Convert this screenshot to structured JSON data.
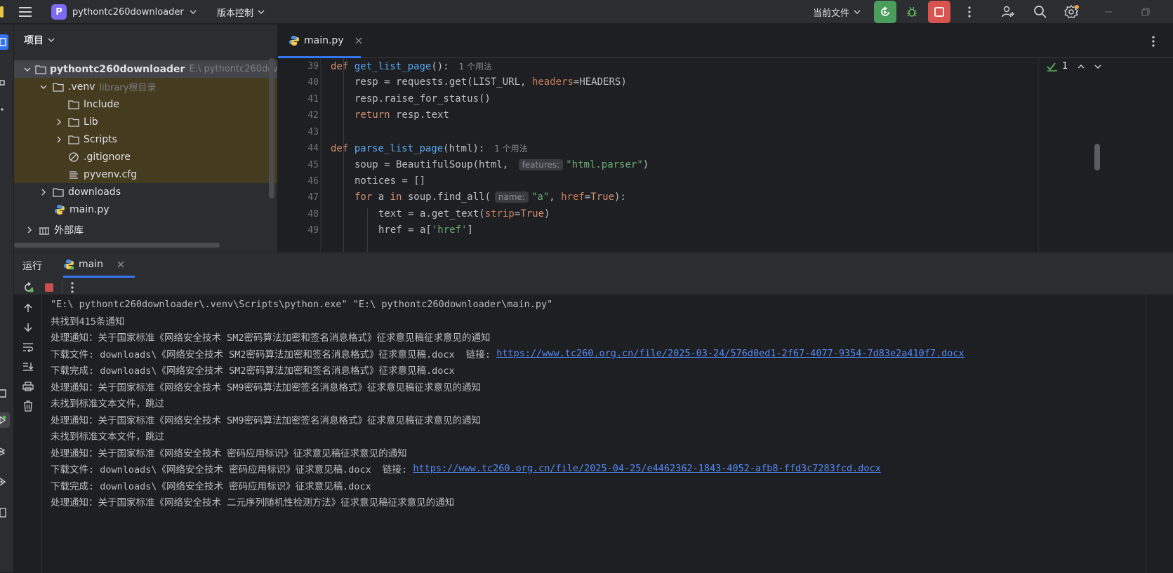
{
  "titlebar": {
    "project_badge": "P",
    "project_name": "pythontc260downloader",
    "vcs_menu": "版本控制",
    "run_config": "当前文件",
    "icons": [
      "hamburger-icon",
      "run-icon",
      "debug-icon",
      "stop-icon",
      "more-icon",
      "add-user-icon",
      "search-icon",
      "settings-icon",
      "minimize-icon",
      "restore-icon"
    ]
  },
  "project_panel": {
    "header": "项目",
    "tree": [
      {
        "label": "pythontc260downloader",
        "hint": "E:\\ pythontc260dow",
        "icon": "folder-icon"
      },
      {
        "label": ".venv",
        "hint": "library根目录",
        "icon": "folder-icon"
      },
      {
        "label": "Include",
        "icon": "folder-icon"
      },
      {
        "label": "Lib",
        "icon": "folder-icon"
      },
      {
        "label": "Scripts",
        "icon": "folder-icon"
      },
      {
        "label": ".gitignore",
        "icon": "ignore-file-icon"
      },
      {
        "label": "pyvenv.cfg",
        "icon": "config-file-icon"
      },
      {
        "label": "downloads",
        "icon": "folder-icon"
      },
      {
        "label": "main.py",
        "icon": "python-file-icon"
      },
      {
        "label": "外部库",
        "icon": "library-icon"
      }
    ]
  },
  "editor": {
    "tab_label": "main.py",
    "inspection_count": "1",
    "lines": [
      {
        "n": "39",
        "usage": "1 个用法"
      },
      {
        "n": "40"
      },
      {
        "n": "41"
      },
      {
        "n": "42"
      },
      {
        "n": "43"
      },
      {
        "n": "44",
        "usage": "1 个用法"
      },
      {
        "n": "45"
      },
      {
        "n": "46"
      },
      {
        "n": "47"
      },
      {
        "n": "48"
      },
      {
        "n": "49"
      }
    ],
    "code": {
      "l39_def": "def",
      "l39_name": "get_list_page",
      "l39_rest": "():",
      "l40_a": "resp = requests.get(LIST_URL, ",
      "l40_b": "headers",
      "l40_c": "=HEADERS)",
      "l41": "resp.raise_for_status()",
      "l42_kw": "return",
      "l42_rest": " resp.text",
      "l44_def": "def",
      "l44_name": "parse_list_page",
      "l44_rest": "(html):",
      "l45_a": "soup = BeautifulSoup(html, ",
      "l45_hint": "features:",
      "l45_str": "\"html.parser\"",
      "l45_c": ")",
      "l46": "notices = []",
      "l47_for": "for",
      "l47_a": " a ",
      "l47_in": "in",
      "l47_b": " soup.find_all(",
      "l47_hint": "name:",
      "l47_str": "\"a\"",
      "l47_c": ", ",
      "l47_param": "href",
      "l47_d": "=",
      "l47_true": "True",
      "l47_e": "):",
      "l48_a": "text = a.get_text(",
      "l48_param": "strip",
      "l48_b": "=",
      "l48_true": "True",
      "l48_c": ")",
      "l49_a": "href = a[",
      "l49_str": "'href'",
      "l49_b": "]"
    }
  },
  "run_panel": {
    "title": "运行",
    "tab_label": "main",
    "console": [
      {
        "text": "\"E:\\ pythontc260downloader\\.venv\\Scripts\\python.exe\" \"E:\\ pythontc260downloader\\main.py\""
      },
      {
        "text": "共找到415条通知"
      },
      {
        "text": "处理通知：关于国家标准《网络安全技术 SM2密码算法加密和签名消息格式》征求意见稿征求意见的通知"
      },
      {
        "text": "下载文件: downloads\\《网络安全技术 SM2密码算法加密和签名消息格式》征求意见稿.docx  链接: ",
        "link": "https://www.tc260.org.cn/file/2025-03-24/576d0ed1-2f67-4077-9354-7d83e2a410f7.docx"
      },
      {
        "text": "下载完成: downloads\\《网络安全技术 SM2密码算法加密和签名消息格式》征求意见稿.docx"
      },
      {
        "text": "处理通知：关于国家标准《网络安全技术 SM9密码算法加密签名消息格式》征求意见稿征求意见的通知"
      },
      {
        "text": "未找到标准文本文件，跳过"
      },
      {
        "text": "处理通知：关于国家标准《网络安全技术 SM9密码算法加密签名消息格式》征求意见稿征求意见的通知"
      },
      {
        "text": "未找到标准文本文件，跳过"
      },
      {
        "text": "处理通知：关于国家标准《网络安全技术 密码应用标识》征求意见稿征求意见的通知"
      },
      {
        "text": "下载文件: downloads\\《网络安全技术 密码应用标识》征求意见稿.docx  链接: ",
        "link": "https://www.tc260.org.cn/file/2025-04-25/e4462362-1843-4052-afb8-ffd3c7283fcd.docx"
      },
      {
        "text": "下载完成: downloads\\《网络安全技术 密码应用标识》征求意见稿.docx"
      },
      {
        "text": "处理通知：关于国家标准《网络安全技术 二元序列随机性检测方法》征求意见稿征求意见的通知"
      }
    ]
  },
  "colors": {
    "accent": "#3574f0",
    "run_green": "#4a9d5b",
    "stop_red": "#d9534f",
    "excluded_bg": "#453b1f",
    "link": "#548af7"
  }
}
